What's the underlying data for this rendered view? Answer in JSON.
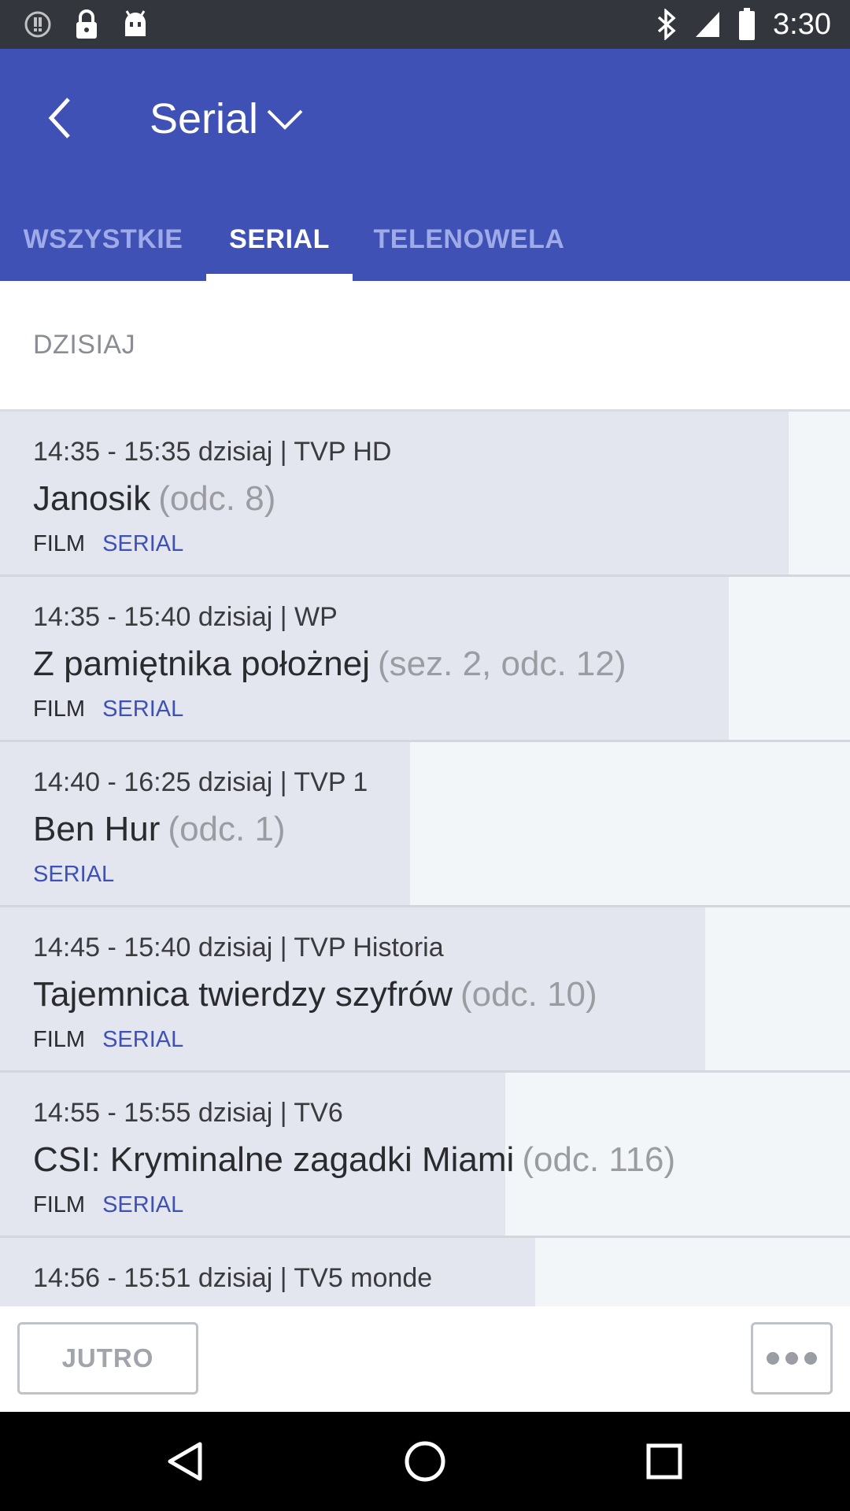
{
  "status_bar": {
    "time": "3:30",
    "left_icons": [
      "alert-circle-icon",
      "lock-icon",
      "android-icon"
    ],
    "right_icons": [
      "bluetooth-icon",
      "signal-icon",
      "battery-icon"
    ]
  },
  "app_bar": {
    "title": "Serial",
    "color": "#3f51b5",
    "tabs": [
      {
        "label": "WSZYSTKIE",
        "active": false
      },
      {
        "label": "SERIAL",
        "active": true
      },
      {
        "label": "TELENOWELA",
        "active": false
      }
    ]
  },
  "section": {
    "label": "DZISIAJ"
  },
  "programs": [
    {
      "time": "14:35 - 15:35 dzisiaj  |  TVP HD",
      "title": "Janosik",
      "episode": "(odc. 8)",
      "tag_film": "FILM",
      "tag_serial": "SERIAL",
      "progress": 0.928
    },
    {
      "time": "14:35 - 15:40 dzisiaj  |  WP",
      "title": "Z pamiętnika położnej",
      "episode": "(sez. 2, odc. 12)",
      "tag_film": "FILM",
      "tag_serial": "SERIAL",
      "progress": 0.857
    },
    {
      "time": "14:40 - 16:25 dzisiaj  |  TVP 1",
      "title": "Ben Hur",
      "episode": "(odc. 1)",
      "tag_film": "",
      "tag_serial": "SERIAL",
      "progress": 0.482
    },
    {
      "time": "14:45 - 15:40 dzisiaj  |  TVP Historia",
      "title": "Tajemnica twierdzy szyfrów",
      "episode": "(odc. 10)",
      "tag_film": "FILM",
      "tag_serial": "SERIAL",
      "progress": 0.83
    },
    {
      "time": "14:55 - 15:55 dzisiaj  |  TV6",
      "title": "CSI: Kryminalne zagadki Miami",
      "episode": "(odc. 116)",
      "tag_film": "FILM",
      "tag_serial": "SERIAL",
      "progress": 0.594
    },
    {
      "time": "14:56 - 15:51 dzisiaj  |  TV5 monde",
      "title": "",
      "episode": "",
      "tag_film": "",
      "tag_serial": "",
      "progress": 0.63
    }
  ],
  "bottom_bar": {
    "next_day_label": "JUTRO",
    "more_icon": "more-horizontal-icon"
  },
  "nav_bar": {
    "icons": [
      "nav-back-icon",
      "nav-home-icon",
      "nav-recent-apps-icon"
    ]
  }
}
